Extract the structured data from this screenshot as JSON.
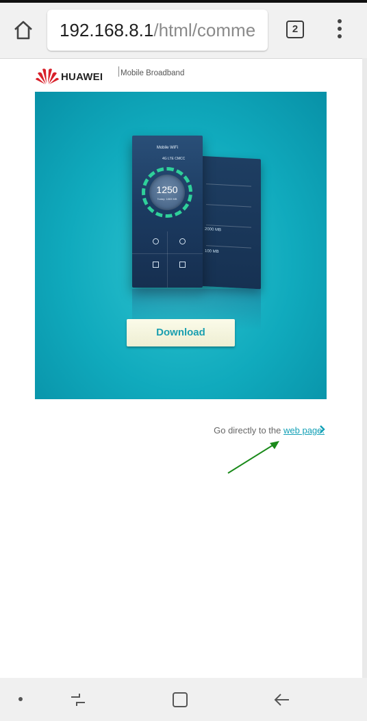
{
  "browser": {
    "url_host": "192.168.8.1",
    "url_path": "/html/comme",
    "tab_count": "2"
  },
  "page": {
    "brand": "HUAWEI",
    "product": "Mobile Broadband",
    "banner": {
      "phone_title": "Mobile WiFi",
      "phone_carrier": "4G LTE CMCC",
      "phone_speed": "1250",
      "phone_speed_sub": "Today: 1883 MB",
      "phone_back_value_1": "2000 MB",
      "phone_back_value_2": "100 MB",
      "download_label": "Download"
    },
    "goto_prefix": "Go directly to the ",
    "goto_link": "web page."
  },
  "colors": {
    "accent": "#12a0b6",
    "banner": "#10aabd",
    "annotation_arrow": "#1a8a1a"
  }
}
